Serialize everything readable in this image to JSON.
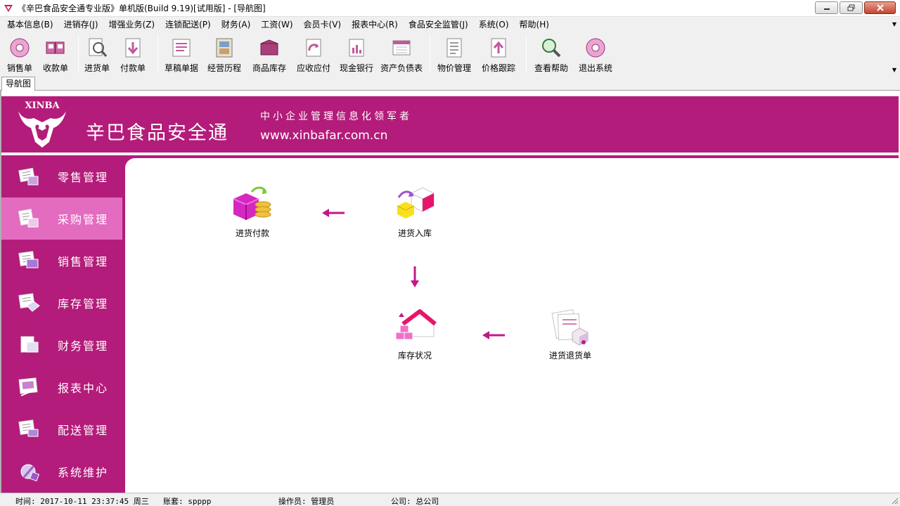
{
  "window": {
    "title": "《辛巴食品安全通专业版》单机版(Build 9.19)[试用版] - [导航图]"
  },
  "menu": [
    {
      "label": "基本信息(B)"
    },
    {
      "label": "进销存(J)"
    },
    {
      "label": "增强业务(Z)"
    },
    {
      "label": "连锁配送(P)"
    },
    {
      "label": "财务(A)"
    },
    {
      "label": "工资(W)"
    },
    {
      "label": "会员卡(V)"
    },
    {
      "label": "报表中心(R)"
    },
    {
      "label": "食品安全监管(J)"
    },
    {
      "label": "系统(O)"
    },
    {
      "label": "帮助(H)"
    }
  ],
  "toolbar": [
    {
      "label": "销售单",
      "icon": "disc-icon"
    },
    {
      "label": "收款单",
      "icon": "book-icon"
    },
    {
      "label": "进货单",
      "icon": "magnifier-doc-icon"
    },
    {
      "label": "付款单",
      "icon": "download-doc-icon"
    },
    {
      "label": "草稿单据",
      "icon": "draft-doc-icon"
    },
    {
      "label": "经营历程",
      "icon": "film-icon"
    },
    {
      "label": "商品库存",
      "icon": "box-icon"
    },
    {
      "label": "应收应付",
      "icon": "refresh-doc-icon"
    },
    {
      "label": "现金银行",
      "icon": "bank-chart-icon"
    },
    {
      "label": "资产负债表",
      "icon": "calculator-icon"
    },
    {
      "label": "物价管理",
      "icon": "price-doc-icon"
    },
    {
      "label": "价格跟踪",
      "icon": "upload-doc-icon"
    },
    {
      "label": "查看帮助",
      "icon": "help-magnifier-icon"
    },
    {
      "label": "退出系统",
      "icon": "exit-disc-icon"
    }
  ],
  "tab": {
    "label": "导航图"
  },
  "banner": {
    "logo_text": "XINBA",
    "brand": "辛巴食品安全通",
    "slogan": "中小企业管理信息化领军者",
    "website": "www.xinbafar.com.cn"
  },
  "sidebar": [
    {
      "label": "零售管理",
      "icon": "retail-icon",
      "active": false
    },
    {
      "label": "采购管理",
      "icon": "purchase-icon",
      "active": true
    },
    {
      "label": "销售管理",
      "icon": "sales-icon",
      "active": false
    },
    {
      "label": "库存管理",
      "icon": "inventory-icon",
      "active": false
    },
    {
      "label": "财务管理",
      "icon": "finance-icon",
      "active": false
    },
    {
      "label": "报表中心",
      "icon": "report-icon",
      "active": false
    },
    {
      "label": "配送管理",
      "icon": "delivery-icon",
      "active": false
    },
    {
      "label": "系统维护",
      "icon": "maintenance-icon",
      "active": false
    }
  ],
  "flow": {
    "nodes": [
      {
        "label": "进货付款",
        "icon": "payment-coins-icon"
      },
      {
        "label": "进货入库",
        "icon": "stock-in-icon"
      },
      {
        "label": "库存状况",
        "icon": "warehouse-icon"
      },
      {
        "label": "进货退货单",
        "icon": "return-goods-icon"
      }
    ]
  },
  "status": {
    "time": "时间: 2017-10-11 23:37:45 周三",
    "account": "账套: spppp",
    "operator": "操作员: 管理员",
    "company": "公司: 总公司"
  },
  "colors": {
    "brand_magenta": "#b31c7a",
    "active_pink": "#e36cc0",
    "arrow_pink": "#c2188a"
  }
}
